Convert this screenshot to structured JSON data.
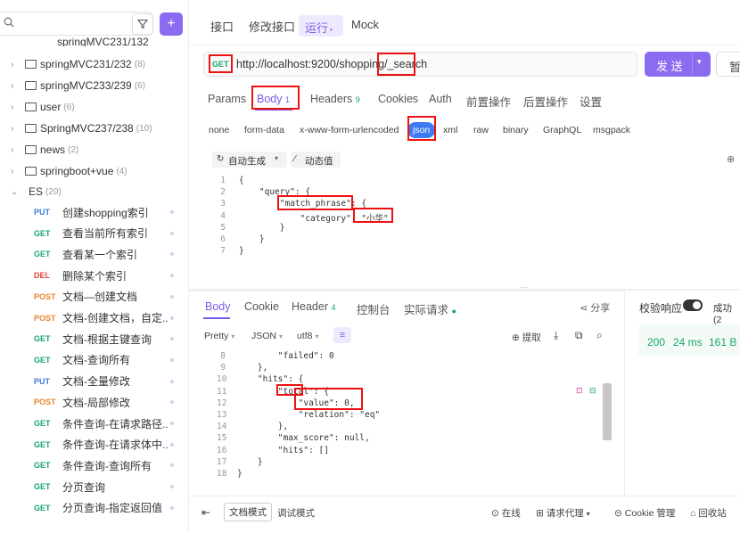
{
  "sidebar": {
    "search_placeholder": "",
    "folders": [
      {
        "label": "springMVC231/232",
        "count": "(8)"
      },
      {
        "label": "springMVC233/239",
        "count": "(6)"
      },
      {
        "label": "user",
        "count": "(6)"
      },
      {
        "label": "SpringMVC237/238",
        "count": "(10)"
      },
      {
        "label": "news",
        "count": "(2)"
      },
      {
        "label": "springboot+vue",
        "count": "(4)"
      },
      {
        "label": "ES",
        "count": "(20)"
      }
    ],
    "partial_folder": "springMVC231/132",
    "apis": [
      {
        "method": "PUT",
        "title": "创建shopping索引"
      },
      {
        "method": "GET",
        "title": "查看当前所有索引"
      },
      {
        "method": "GET",
        "title": "查看某一个索引"
      },
      {
        "method": "DEL",
        "title": "删除某个索引"
      },
      {
        "method": "POST",
        "title": "文档—创建文档"
      },
      {
        "method": "POST",
        "title": "文档-创建文档，自定..."
      },
      {
        "method": "GET",
        "title": "文档-根据主键查询"
      },
      {
        "method": "GET",
        "title": "文档-查询所有"
      },
      {
        "method": "PUT",
        "title": "文档-全量修改"
      },
      {
        "method": "POST",
        "title": "文档-局部修改"
      },
      {
        "method": "GET",
        "title": "条件查询-在请求路径..."
      },
      {
        "method": "GET",
        "title": "条件查询-在请求体中..."
      },
      {
        "method": "GET",
        "title": "条件查询-查询所有"
      },
      {
        "method": "GET",
        "title": "分页查询"
      },
      {
        "method": "GET",
        "title": "分页查询-指定返回值"
      }
    ]
  },
  "top_tabs": {
    "api": "接口",
    "edit": "修改接口",
    "run": "运行",
    "mock": "Mock"
  },
  "request": {
    "method": "GET",
    "url": "http://localhost:9200/shopping/_search",
    "send": "发 送",
    "save": "暂"
  },
  "sub_tabs": {
    "params": "Params",
    "body": "Body",
    "body_count": "1",
    "headers": "Headers",
    "headers_count": "9",
    "cookies": "Cookies",
    "auth": "Auth",
    "pre": "前置操作",
    "post": "后置操作",
    "settings": "设置"
  },
  "body_types": [
    "none",
    "form-data",
    "x-www-form-urlencoded",
    "json",
    "xml",
    "raw",
    "binary",
    "GraphQL",
    "msgpack"
  ],
  "editor_tools": {
    "auto": "自动生成",
    "dynamic": "动态值"
  },
  "request_body": {
    "line_numbers": [
      "1",
      "2",
      "3",
      "4",
      "5",
      "6",
      "7"
    ],
    "lines": [
      "{",
      "    \"query\": {",
      "        \"match_phrase\": {",
      "            \"category\": \"小华\"",
      "        }",
      "    }",
      "}"
    ]
  },
  "response_tabs": {
    "body": "Body",
    "cookie": "Cookie",
    "header": "Header",
    "header_count": "4",
    "console": "控制台",
    "actual": "实际请求",
    "share": "分享"
  },
  "response_tools": {
    "pretty": "Pretty",
    "json": "JSON",
    "utf8": "utf8",
    "extract": "提取"
  },
  "response_body": {
    "line_numbers": [
      "8",
      "9",
      "10",
      "11",
      "12",
      "13",
      "14",
      "15",
      "16",
      "17",
      "18"
    ],
    "lines": [
      "        \"failed\": 0",
      "    },",
      "    \"hits\": {",
      "        \"total\": {",
      "            \"value\": 0,",
      "            \"relation\": \"eq\"",
      "        },",
      "        \"max_score\": null,",
      "        \"hits\": []",
      "    }",
      "}"
    ]
  },
  "right_panel": {
    "validate": "校验响应",
    "success": "成功 (2",
    "status": "200",
    "time": "24 ms",
    "size": "161 B"
  },
  "footer": {
    "doc_mode": "文档模式",
    "debug_mode": "调试模式",
    "online": "在线",
    "proxy": "请求代理",
    "cookie": "Cookie 管理",
    "recycle": "回收站"
  }
}
